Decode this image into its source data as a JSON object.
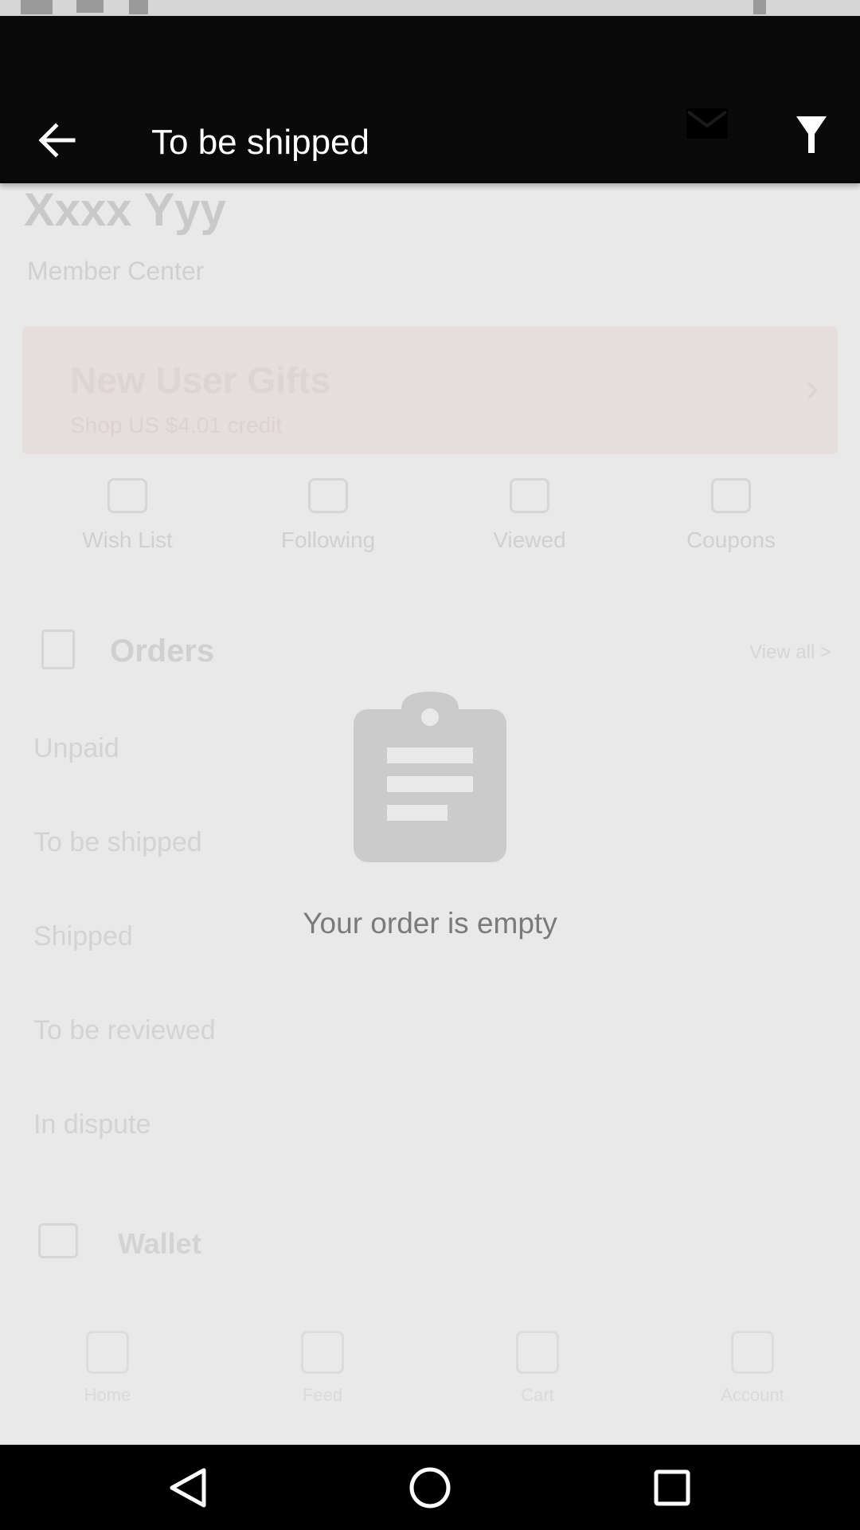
{
  "app_bar": {
    "title": "To be shipped",
    "back_icon": "arrow-left-icon",
    "mail_icon": "mail-icon",
    "filter_icon": "filter-icon"
  },
  "background": {
    "name": "Xxxx Yyy",
    "member_center": "Member Center",
    "banner_title": "New User Gifts",
    "banner_sub": "Shop US $4.01 credit",
    "quick_links": [
      "Wish List",
      "Following",
      "Viewed",
      "Coupons"
    ],
    "orders_title": "Orders",
    "view_all": "View all >",
    "order_rows": [
      "Unpaid",
      "To be shipped",
      "Shipped",
      "To be reviewed",
      "In dispute"
    ],
    "wallet": "Wallet",
    "tabs": [
      "Home",
      "Feed",
      "Cart",
      "Account"
    ]
  },
  "empty_state": {
    "icon": "clipboard-icon",
    "message": "Your order is empty"
  },
  "colors": {
    "app_bar": "#0a0a0a",
    "overlay_bg": "#e9e9ea",
    "empty_icon": "#cbcbcb",
    "empty_text": "#7a7a7a"
  }
}
